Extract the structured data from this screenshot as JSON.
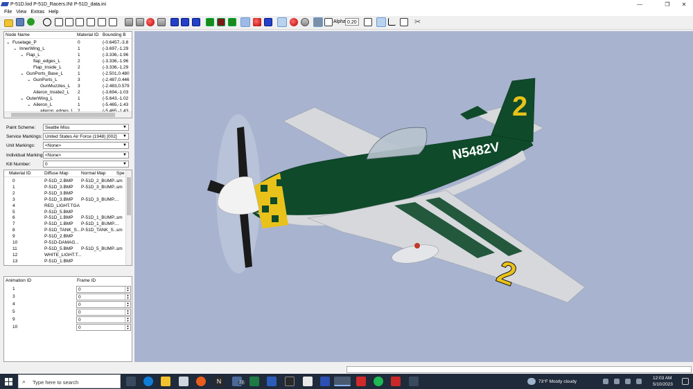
{
  "window": {
    "title": "P-51D.lod  P-51D_Racers.INI  P-51D_data.ini",
    "minimize": "—",
    "restore": "❐",
    "close": "✕"
  },
  "menu": [
    "File",
    "View",
    "Extras",
    "Help"
  ],
  "toolbar": {
    "alpha_label": "Alpha:",
    "alpha_value": "0.20"
  },
  "node_tree": {
    "headers": [
      "Node Name",
      "Material ID",
      "Bounding B"
    ],
    "rows": [
      {
        "expander": "⌄",
        "name": "Fuselage_P",
        "mat": "0",
        "bb": "(-0.6457,-3.8"
      },
      {
        "expander": "⌄",
        "name": "InnerWing_L",
        "mat": "1",
        "bb": "(-3.697,-1.29"
      },
      {
        "expander": "⌄",
        "name": "Flap_L",
        "mat": "1",
        "bb": "(-3.336,-1.96"
      },
      {
        "expander": "",
        "name": "flap_edges_L",
        "mat": "2",
        "bb": "(-3.336,-1.96"
      },
      {
        "expander": "",
        "name": "Flap_Inside_L",
        "mat": "2",
        "bb": "(-3.336,-1.29"
      },
      {
        "expander": "⌄",
        "name": "GunPorts_Base_L",
        "mat": "1",
        "bb": "(-2.501,0.480"
      },
      {
        "expander": "⌄",
        "name": "GunPorts_L",
        "mat": "3",
        "bb": "(-2.487,0.446"
      },
      {
        "expander": "",
        "name": "GunMuzzles_L",
        "mat": "3",
        "bb": "(-2.483,0.579"
      },
      {
        "expander": "",
        "name": "Aileron_Inside2_L",
        "mat": "2",
        "bb": "(-3.694,-1.03"
      },
      {
        "expander": "⌄",
        "name": "OuterWing_L",
        "mat": "1",
        "bb": "(-5.643,-1.02"
      },
      {
        "expander": "⌄",
        "name": "Aileron_L",
        "mat": "1",
        "bb": "(-5.465,-1.43"
      },
      {
        "expander": "",
        "name": "aileron_edges_L",
        "mat": "2",
        "bb": "(-5.465,-1.43"
      }
    ]
  },
  "fields": [
    {
      "label": "Paint Scheme:",
      "value": "Seattle Miss"
    },
    {
      "label": "Service Markings:",
      "value": "United States Air Force (1948) [002]"
    },
    {
      "label": "Unit Markings:",
      "value": "<None>"
    },
    {
      "label": "Individual Markings:",
      "value": "<None>"
    },
    {
      "label": "Kill Number:",
      "value": "0"
    }
  ],
  "materials": {
    "headers": [
      "Material ID",
      "Diffuse Map",
      "Normal Map",
      "Spe"
    ],
    "rows": [
      {
        "id": "0",
        "diffuse": "P-51D_2.BMP",
        "normal": "P-51D_2_BUMP....",
        "spec": "sm"
      },
      {
        "id": "1",
        "diffuse": "P-51D_3.BMP",
        "normal": "P-51D_3_BUMP....",
        "spec": "sm"
      },
      {
        "id": "2",
        "diffuse": "P-51D_3.BMP",
        "normal": "",
        "spec": ""
      },
      {
        "id": "3",
        "diffuse": "P-51D_3.BMP",
        "normal": "P-51D_3_BUMP....",
        "spec": ""
      },
      {
        "id": "4",
        "diffuse": "RED_LIGHT.TGA",
        "normal": "",
        "spec": ""
      },
      {
        "id": "5",
        "diffuse": "P-51D_5.BMP",
        "normal": "",
        "spec": ""
      },
      {
        "id": "6",
        "diffuse": "P-51D_1.BMP",
        "normal": "P-51D_1_BUMP....",
        "spec": "sm"
      },
      {
        "id": "7",
        "diffuse": "P-51D_1.BMP",
        "normal": "P-51D_1_BUMP....",
        "spec": ""
      },
      {
        "id": "8",
        "diffuse": "P-51D_TANK_S...",
        "normal": "P-51D_TANK_S...",
        "spec": "sm"
      },
      {
        "id": "9",
        "diffuse": "P-51D_2.BMP",
        "normal": "",
        "spec": ""
      },
      {
        "id": "10",
        "diffuse": "P-51D-DAMAG...",
        "normal": "",
        "spec": ""
      },
      {
        "id": "11",
        "diffuse": "P-51D_5.BMP",
        "normal": "P-51D_5_BUMP....",
        "spec": "sm"
      },
      {
        "id": "12",
        "diffuse": "WHITE_LIGHT.T...",
        "normal": "",
        "spec": ""
      },
      {
        "id": "13",
        "diffuse": "P-51D_1.BMP",
        "normal": "",
        "spec": ""
      }
    ]
  },
  "animations": {
    "headers": [
      "Animation ID",
      "Frame ID"
    ],
    "rows": [
      {
        "id": "1",
        "frame": "0"
      },
      {
        "id": "3",
        "frame": "0"
      },
      {
        "id": "4",
        "frame": "0"
      },
      {
        "id": "5",
        "frame": "0"
      },
      {
        "id": "9",
        "frame": "0"
      },
      {
        "id": "10",
        "frame": "0"
      }
    ]
  },
  "aircraft": {
    "registration": "N5482V",
    "race_number": "2",
    "colors": {
      "green": "#0f4a2a",
      "yellow": "#e8c21a",
      "silver": "#d6d8dc"
    }
  },
  "taskbar": {
    "search_placeholder": "Type here to search",
    "weather": "73°F  Mostly cloudy",
    "time": "12:03 AM",
    "date": "5/10/2023",
    "badge": "22"
  }
}
